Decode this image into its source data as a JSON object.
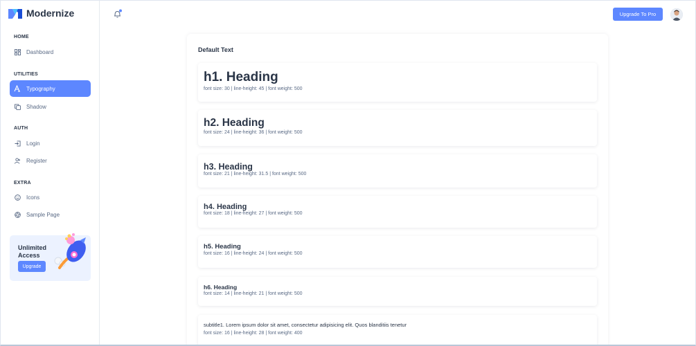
{
  "brand": {
    "name": "Modernize",
    "accent": "#5d87ff"
  },
  "sidebar": {
    "sections": [
      {
        "caption": "HOME"
      },
      {
        "caption": "UTILITIES"
      },
      {
        "caption": "AUTH"
      },
      {
        "caption": "EXTRA"
      }
    ],
    "items": [
      {
        "label": "Dashboard",
        "icon": "dashboard-icon"
      },
      {
        "label": "Typography",
        "icon": "typography-icon",
        "active": true
      },
      {
        "label": "Shadow",
        "icon": "copy-icon"
      },
      {
        "label": "Login",
        "icon": "login-icon"
      },
      {
        "label": "Register",
        "icon": "user-plus-icon"
      },
      {
        "label": "Icons",
        "icon": "mood-icon"
      },
      {
        "label": "Sample Page",
        "icon": "aperture-icon"
      }
    ],
    "promo": {
      "title": "Unlimited Access",
      "button": "Upgrade"
    }
  },
  "header": {
    "upgrade_button": "Upgrade To Pro"
  },
  "card": {
    "title": "Default Text",
    "rows": [
      {
        "heading": "h1. Heading",
        "meta": "font size: 30 | line-height: 45 | font weight: 500"
      },
      {
        "heading": "h2. Heading",
        "meta": "font size: 24 | line-height: 36 | font weight: 500"
      },
      {
        "heading": "h3. Heading",
        "meta": "font size: 21 | line-height: 31.5 | font weight: 500"
      },
      {
        "heading": "h4. Heading",
        "meta": "font size: 18 | line-height: 27 | font weight: 500"
      },
      {
        "heading": "h5. Heading",
        "meta": "font size: 16 | line-height: 24 | font weight: 500"
      },
      {
        "heading": "h6. Heading",
        "meta": "font size: 14 | line-height: 21 | font weight: 500"
      },
      {
        "heading": "subtitle1. Lorem ipsum dolor sit amet, consectetur adipisicing elit. Quos blanditiis tenetur",
        "meta": "font size: 16 | line-height: 28 | font weight: 400"
      }
    ]
  }
}
